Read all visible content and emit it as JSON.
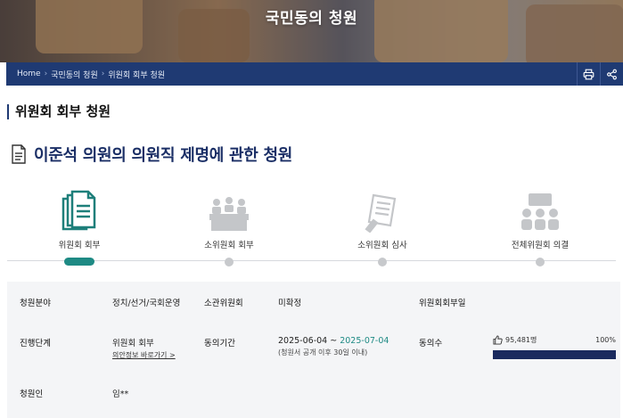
{
  "hero": {
    "title": "국민동의 청원"
  },
  "breadcrumb": [
    "Home",
    "국민동의 청원",
    "위원회 회부 청원"
  ],
  "toolbar": {
    "print_icon": "printer-icon",
    "share_icon": "share-icon"
  },
  "section_title": "위원회 회부 청원",
  "petition_title": "이준석 의원의 의원직 제명에 관한 청원",
  "steps": [
    {
      "label": "위원회 회부",
      "icon": "documents-icon",
      "active": true
    },
    {
      "label": "소위원회 회부",
      "icon": "meeting-icon",
      "active": false
    },
    {
      "label": "소위원회 심사",
      "icon": "review-icon",
      "active": false
    },
    {
      "label": "전체위원회 의결",
      "icon": "people-icon",
      "active": false
    }
  ],
  "info": {
    "field_label": "청원분야",
    "field_value": "정치/선거/국회운영",
    "committee_label": "소관위원회",
    "committee_value": "미확정",
    "referral_date_label": "위원회회부일",
    "stage_label": "진행단계",
    "stage_value": "위원회 회부",
    "stage_link": "의안정보 바로가기 >",
    "period_label": "동의기간",
    "period_start": "2025-06-04 ~ ",
    "period_end": "2025-07-04",
    "period_note": "(청원서 공개 이후 30일 이내)",
    "agree_label": "동의수",
    "agree_count": "95,481명",
    "agree_percent_text": "100%",
    "agree_percent": 100,
    "petitioner_label": "청원인",
    "petitioner_value": "임**"
  },
  "colors": {
    "navy": "#1f3a73",
    "teal": "#1e8a84",
    "bar": "#1a2a5e"
  }
}
